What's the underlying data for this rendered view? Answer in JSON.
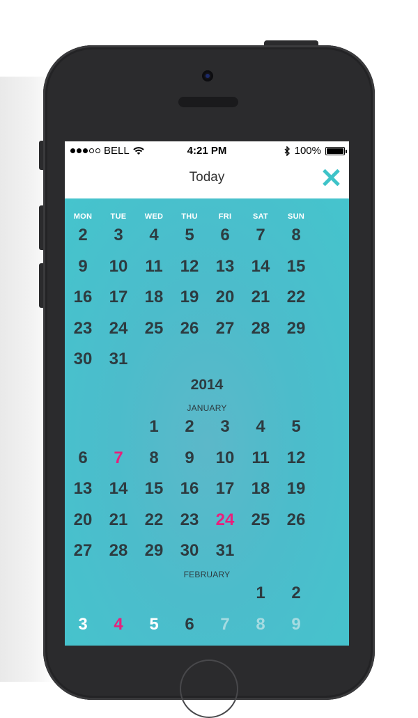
{
  "status_bar": {
    "carrier": "BELL",
    "time": "4:21 PM",
    "battery": "100%"
  },
  "navbar": {
    "title": "Today",
    "close_icon": "close-x-icon",
    "accent_color": "#3ec3c8"
  },
  "calendar": {
    "weekdays": [
      "MON",
      "TUE",
      "WED",
      "THU",
      "FRI",
      "SAT",
      "SUN"
    ],
    "background_color": "#45c4cd",
    "highlight_color": "#e8207c",
    "prev_month_days": [
      [
        2,
        3,
        4,
        5,
        6,
        7,
        8
      ],
      [
        9,
        10,
        11,
        12,
        13,
        14,
        15
      ],
      [
        16,
        17,
        18,
        19,
        20,
        21,
        22
      ],
      [
        23,
        24,
        25,
        26,
        27,
        28,
        29
      ],
      [
        30,
        31
      ]
    ],
    "year": "2014",
    "january": {
      "label": "JANUARY",
      "weeks": [
        [
          null,
          null,
          1,
          2,
          3,
          4,
          5
        ],
        [
          6,
          7,
          8,
          9,
          10,
          11,
          12
        ],
        [
          13,
          14,
          15,
          16,
          17,
          18,
          19
        ],
        [
          20,
          21,
          22,
          23,
          24,
          25,
          26
        ],
        [
          27,
          28,
          29,
          30,
          31
        ]
      ],
      "highlighted_days": [
        7,
        24
      ]
    },
    "february": {
      "label": "FEBRUARY",
      "weeks": [
        [
          null,
          null,
          null,
          null,
          null,
          1,
          2
        ],
        [
          3,
          4,
          5,
          6,
          7,
          8,
          9
        ]
      ],
      "highlighted_days": [
        4
      ],
      "white_days": [
        3,
        5
      ],
      "faded_days": [
        7,
        8,
        9
      ]
    }
  }
}
